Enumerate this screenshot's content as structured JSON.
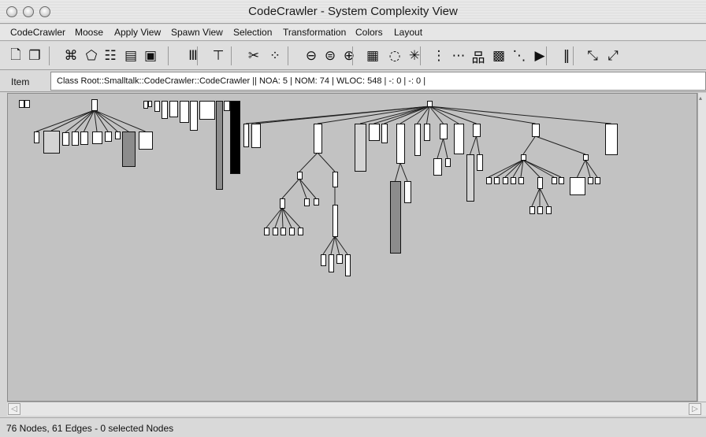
{
  "window": {
    "title": "CodeCrawler - System Complexity View"
  },
  "menubar": {
    "items": [
      "CodeCrawler",
      "Moose",
      "Apply View",
      "Spawn View",
      "Selection",
      "Transformation",
      "Colors",
      "Layout"
    ]
  },
  "toolbar": {
    "icons": [
      {
        "name": "new-document-icon",
        "glyph": "🗋"
      },
      {
        "name": "copy-view-icon",
        "glyph": "❐"
      },
      {
        "name": "graph-layout-icon",
        "glyph": "⌘"
      },
      {
        "name": "select-lasso-icon",
        "glyph": "⬠"
      },
      {
        "name": "list-view-icon",
        "glyph": "☷"
      },
      {
        "name": "metrics-table-icon",
        "glyph": "▤"
      },
      {
        "name": "inspector-icon",
        "glyph": "▣"
      },
      {
        "name": "column-layout-icon",
        "glyph": "Ⅲ"
      },
      {
        "name": "tree-layout-icon",
        "glyph": "⊤"
      },
      {
        "name": "cut-icon",
        "glyph": "✂"
      },
      {
        "name": "scatter-layout-icon",
        "glyph": "⁘"
      },
      {
        "name": "zoom-out-icon",
        "glyph": "⊖"
      },
      {
        "name": "zoom-fit-icon",
        "glyph": "⊜"
      },
      {
        "name": "zoom-in-icon",
        "glyph": "⊕"
      },
      {
        "name": "grid-layout-icon",
        "glyph": "▦"
      },
      {
        "name": "circle-layout-icon",
        "glyph": "◌"
      },
      {
        "name": "radial-layout-icon",
        "glyph": "✳"
      },
      {
        "name": "vertical-line-layout-icon",
        "glyph": "⋮"
      },
      {
        "name": "horizontal-line-layout-icon",
        "glyph": "⋯"
      },
      {
        "name": "hierarchy-layout-icon",
        "glyph": "品"
      },
      {
        "name": "matrix-layout-icon",
        "glyph": "▩"
      },
      {
        "name": "diagonal-layout-icon",
        "glyph": "⋱"
      },
      {
        "name": "play-icon",
        "glyph": "▶"
      },
      {
        "name": "histogram-layout-icon",
        "glyph": "‖"
      },
      {
        "name": "spring-layout-icon",
        "glyph": "⤡"
      },
      {
        "name": "force-layout-icon",
        "glyph": "⤢"
      }
    ]
  },
  "item_bar": {
    "label": "Item",
    "value": "Class Root::Smalltalk::CodeCrawler::CodeCrawler || NOA: 5 | NOM: 74 | WLOC: 548 | -: 0 | -: 0 |"
  },
  "status": {
    "text": "76 Nodes, 61 Edges - 0 selected Nodes"
  },
  "colors": {
    "canvas": "#c2c2c2",
    "node_white": "#ffffff",
    "node_light": "#d4d4d4",
    "node_gray": "#8c8c8c",
    "node_dark": "#000000",
    "edge": "#222222"
  }
}
